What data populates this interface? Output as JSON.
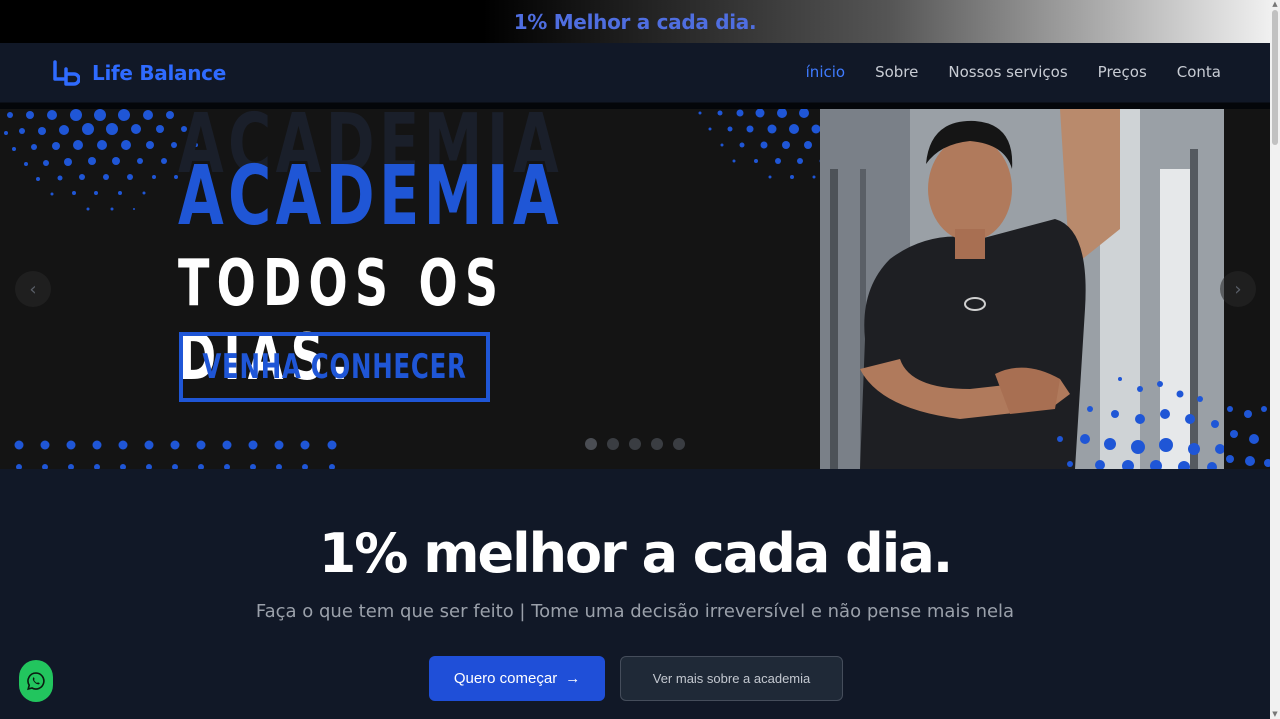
{
  "announcement": {
    "text": "1% Melhor a cada dia."
  },
  "header": {
    "brand": "Life Balance",
    "logo_icon": "lb-logo-icon",
    "nav": [
      {
        "label": "ínicio",
        "active": true
      },
      {
        "label": "Sobre",
        "active": false
      },
      {
        "label": "Nossos serviços",
        "active": false
      },
      {
        "label": "Preços",
        "active": false
      },
      {
        "label": "Conta",
        "active": false
      }
    ]
  },
  "carousel": {
    "slide": {
      "headline_top": "ACADEMIA",
      "headline_bottom": "TODOS OS DIAS.",
      "cta": "VENHA CONHECER"
    },
    "prev_icon": "chevron-left-icon",
    "next_icon": "chevron-right-icon",
    "prev_glyph": "‹",
    "next_glyph": "›",
    "slide_count": 5,
    "active_index": 0
  },
  "hero": {
    "title": "1% melhor a cada dia.",
    "subtitle": "Faça o que tem que ser feito | Tome uma decisão irreversível e não pense mais nela",
    "primary_button": "Quero começar",
    "primary_button_arrow": "→",
    "secondary_button": "Ver mais sobre a academia"
  },
  "floating": {
    "whatsapp_icon": "whatsapp-icon"
  },
  "colors": {
    "accent": "#1f4fd8",
    "brand": "#2f6bff",
    "background": "#111827",
    "whatsapp": "#22c55e"
  }
}
